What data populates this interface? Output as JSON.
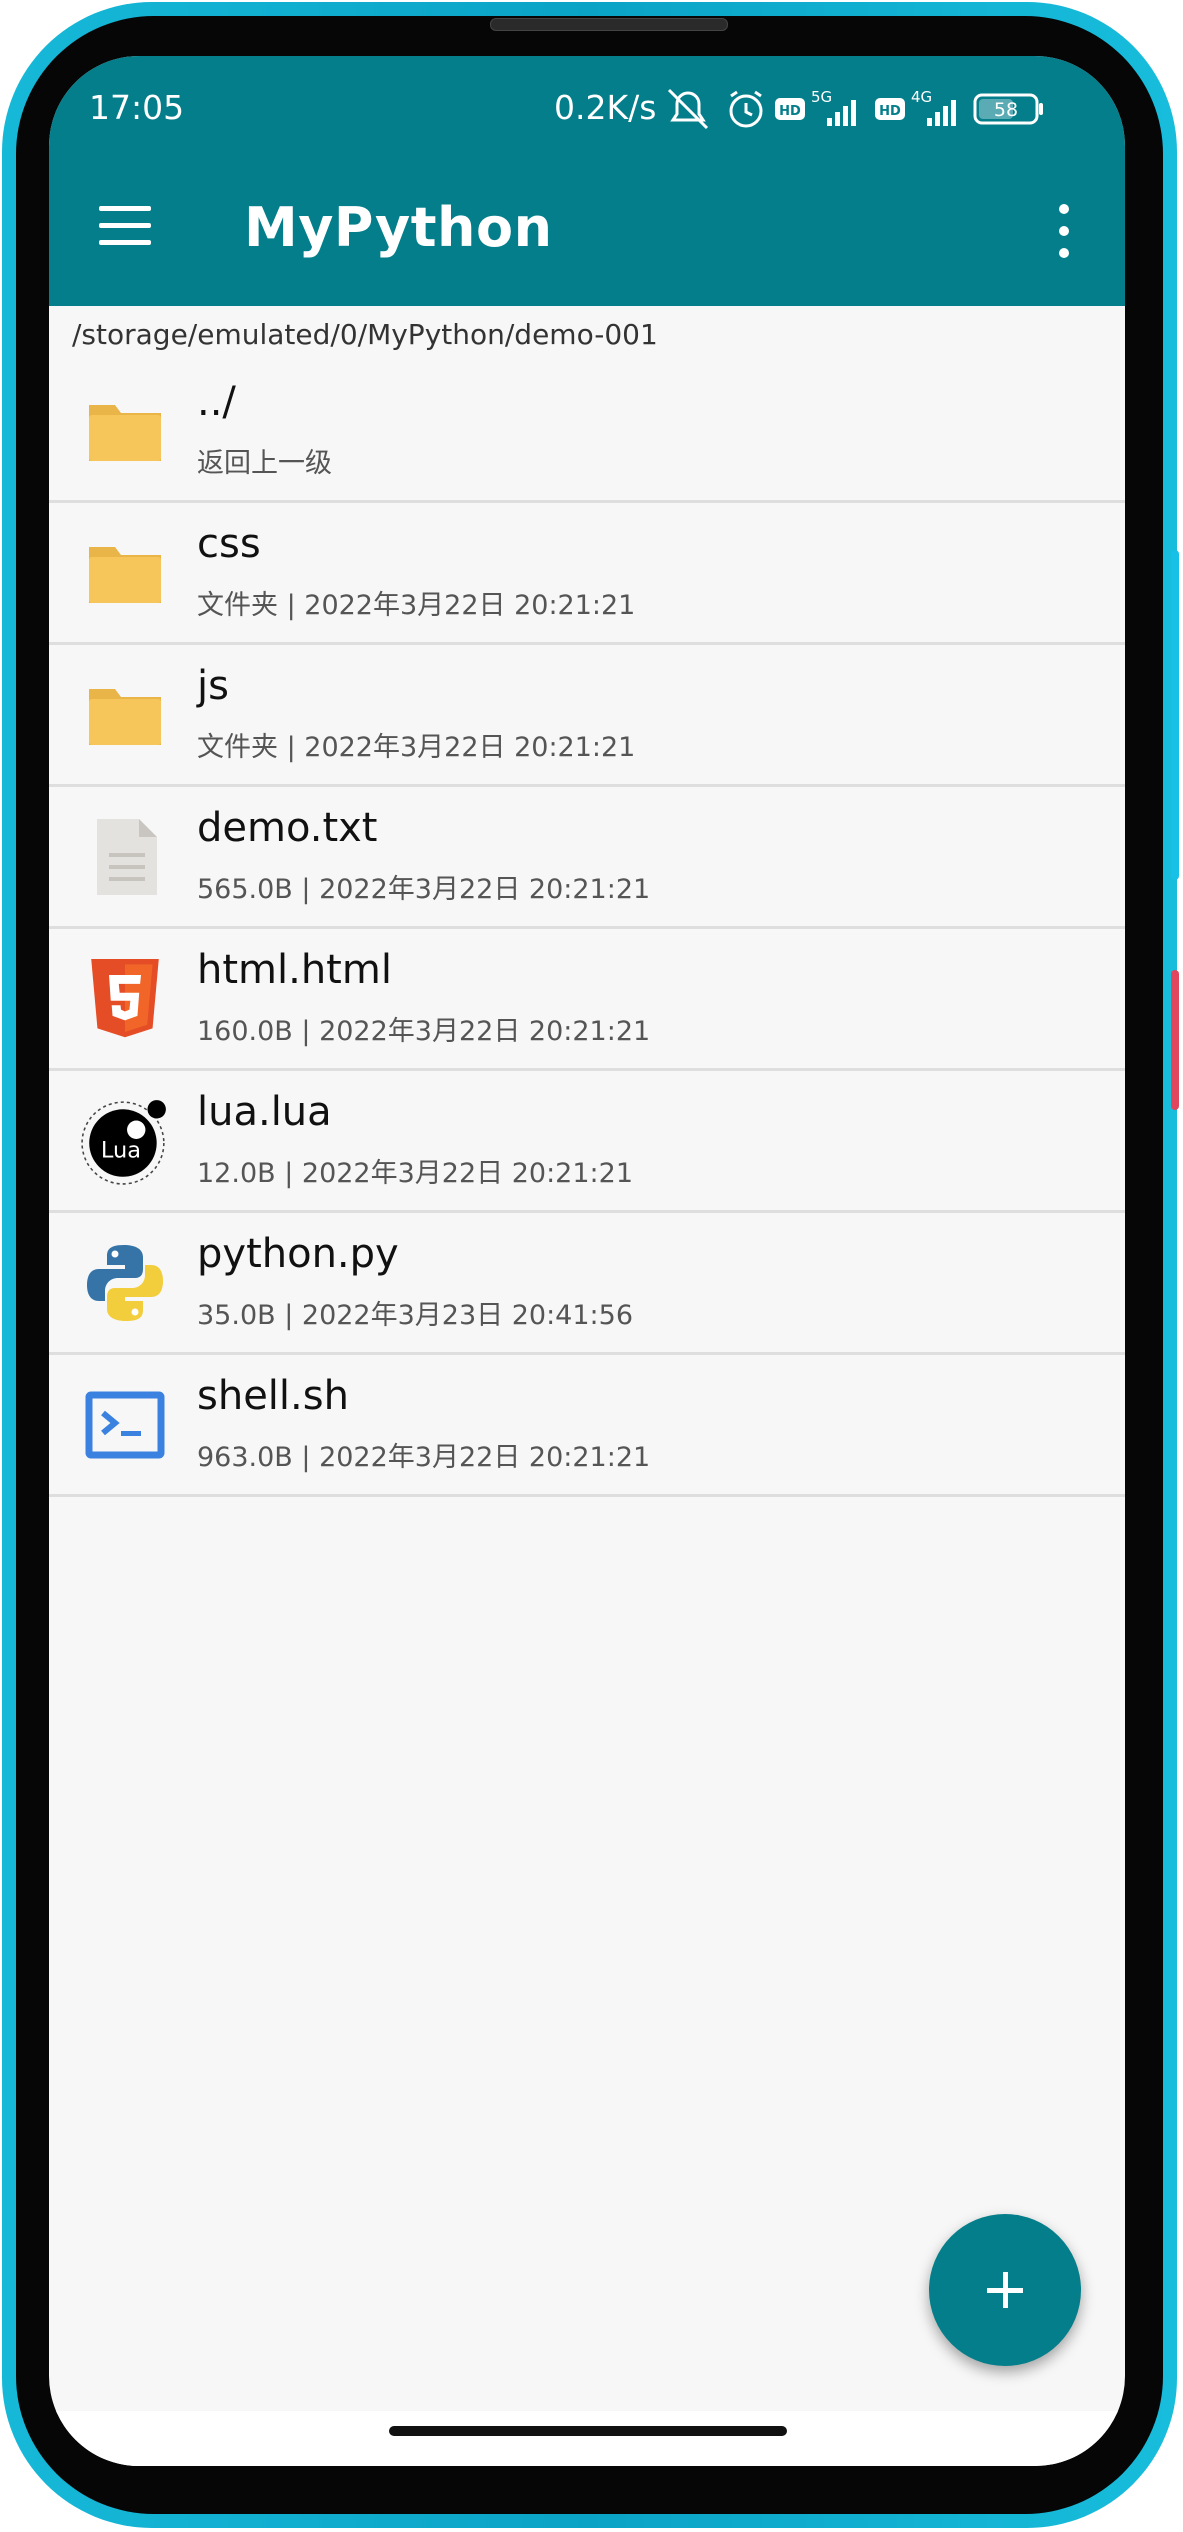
{
  "status_bar": {
    "time": "17:05",
    "network_speed": "0.2K/s",
    "battery": "58",
    "sim1_label": "5G",
    "sim2_label": "4G",
    "hd_label": "HD"
  },
  "app_bar": {
    "title": "MyPython"
  },
  "path": "/storage/emulated/0/MyPython/demo-001",
  "files": [
    {
      "name": "../",
      "meta": "返回上一级",
      "icon": "folder-icon"
    },
    {
      "name": "css",
      "meta": "文件夹 | 2022年3月22日 20:21:21",
      "icon": "folder-icon"
    },
    {
      "name": "js",
      "meta": "文件夹 | 2022年3月22日 20:21:21",
      "icon": "folder-icon"
    },
    {
      "name": "demo.txt",
      "meta": "565.0B | 2022年3月22日 20:21:21",
      "icon": "text-file-icon"
    },
    {
      "name": "html.html",
      "meta": "160.0B | 2022年3月22日 20:21:21",
      "icon": "html5-icon"
    },
    {
      "name": "lua.lua",
      "meta": "12.0B | 2022年3月22日 20:21:21",
      "icon": "lua-icon",
      "icon_text": "Lua"
    },
    {
      "name": "python.py",
      "meta": "35.0B | 2022年3月23日 20:41:56",
      "icon": "python-icon"
    },
    {
      "name": "shell.sh",
      "meta": "963.0B | 2022年3月22日 20:21:21",
      "icon": "terminal-icon"
    }
  ],
  "fab": {
    "icon": "plus-icon",
    "label": "+"
  },
  "colors": {
    "primary": "#037e8a",
    "folder": "#f7c65a",
    "html5": "#e44d26",
    "python_blue": "#3674a8",
    "python_yellow": "#f2cd3c",
    "terminal": "#3b82e0"
  }
}
